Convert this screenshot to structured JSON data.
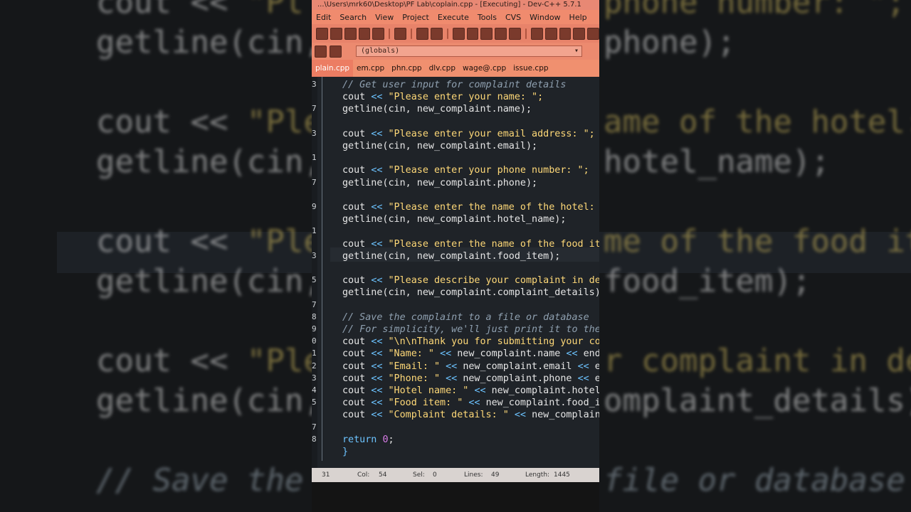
{
  "window": {
    "title": "...\\Users\\mrk60\\Desktop\\PF Lab\\coplain.cpp - [Executing] - Dev-C++ 5.7.1",
    "menu": [
      "Edit",
      "Search",
      "View",
      "Project",
      "Execute",
      "Tools",
      "CVS",
      "Window",
      "Help"
    ],
    "scope_select": "(globals)",
    "tabs": [
      "plain.cpp",
      "em.cpp",
      "phn.cpp",
      "dlv.cpp",
      "wage@.cpp",
      "issue.cpp"
    ],
    "active_tab": "plain.cpp"
  },
  "code": {
    "gutter": [
      "3",
      "",
      "7",
      "",
      "3",
      "",
      "1",
      "",
      "7",
      "",
      "9",
      "",
      "1",
      "",
      "3",
      "",
      "5",
      "",
      "7",
      "8",
      "9",
      "0",
      "1",
      "2",
      "3",
      "4",
      "5",
      "",
      "7",
      "8"
    ],
    "lines": [
      {
        "text": "// Get user input for complaint details",
        "kind": "comment"
      },
      {
        "a": "cout ",
        "b": "<< ",
        "c": "\"Please enter your name: \";",
        "kind": "cout"
      },
      {
        "a": "getline(cin, new_complaint.name);",
        "kind": "plain"
      },
      {
        "a": "",
        "kind": "blank"
      },
      {
        "a": "cout ",
        "b": "<< ",
        "c": "\"Please enter your email address: \";",
        "kind": "cout"
      },
      {
        "a": "getline(cin, new_complaint.email);",
        "kind": "plain"
      },
      {
        "a": "",
        "kind": "blank"
      },
      {
        "a": "cout ",
        "b": "<< ",
        "c": "\"Please enter your phone number: \";",
        "kind": "cout"
      },
      {
        "a": "getline(cin, new_complaint.phone);",
        "kind": "plain"
      },
      {
        "a": "",
        "kind": "blank"
      },
      {
        "a": "cout ",
        "b": "<< ",
        "c": "\"Please enter the name of the hotel: ",
        "kind": "cout"
      },
      {
        "a": "getline(cin, new_complaint.hotel_name);",
        "kind": "plain"
      },
      {
        "a": "",
        "kind": "blank"
      },
      {
        "a": "cout ",
        "b": "<< ",
        "c": "\"Please enter the name of the food it",
        "kind": "cout"
      },
      {
        "a": "getline(cin, new_complaint.food_item);",
        "kind": "plain"
      },
      {
        "a": "",
        "kind": "blank"
      },
      {
        "a": "cout ",
        "b": "<< ",
        "c": "\"Please describe your complaint in de",
        "kind": "cout"
      },
      {
        "a": "getline(cin, new_complaint.complaint_details);",
        "kind": "plain"
      },
      {
        "a": "",
        "kind": "blank"
      },
      {
        "text": "// Save the complaint to a file or database",
        "kind": "comment"
      },
      {
        "text": "// For simplicity, we'll just print it to the",
        "kind": "comment"
      },
      {
        "a": "cout ",
        "b": "<< ",
        "c": "\"\\n\\nThank you for submitting your com",
        "kind": "cout"
      },
      {
        "a": "cout ",
        "b": "<< ",
        "c": "\"Name: \" ",
        "d": "<< ",
        "e": "new_complaint.name ",
        "f": "<< ",
        "g": "endl",
        "kind": "cout2"
      },
      {
        "a": "cout ",
        "b": "<< ",
        "c": "\"Email: \" ",
        "d": "<< ",
        "e": "new_complaint.email ",
        "f": "<< ",
        "g": "en",
        "kind": "cout2"
      },
      {
        "a": "cout ",
        "b": "<< ",
        "c": "\"Phone: \" ",
        "d": "<< ",
        "e": "new_complaint.phone ",
        "f": "<< ",
        "g": "en",
        "kind": "cout2"
      },
      {
        "a": "cout ",
        "b": "<< ",
        "c": "\"Hotel name: \" ",
        "d": "<< ",
        "e": "new_complaint.hotel_",
        "kind": "cout2"
      },
      {
        "a": "cout ",
        "b": "<< ",
        "c": "\"Food item: \" ",
        "d": "<< ",
        "e": "new_complaint.food_it",
        "kind": "cout2"
      },
      {
        "a": "cout ",
        "b": "<< ",
        "c": "\"Complaint details: \" ",
        "d": "<< ",
        "e": "new_complaint",
        "kind": "cout2"
      },
      {
        "a": "",
        "kind": "blank"
      },
      {
        "a": "return ",
        "n": "0",
        "z": ";",
        "kind": "return"
      },
      {
        "a": "}",
        "kind": "brace"
      }
    ]
  },
  "status": {
    "line": "31",
    "col_label": "Col:",
    "col": "54",
    "sel_label": "Sel:",
    "sel": "0",
    "lines_label": "Lines:",
    "lines": "49",
    "length_label": "Length:",
    "length": "1445"
  },
  "background_zoom": {
    "lines": [
      {
        "a": "cout << ",
        "s": "\"Pl",
        "right": "phone number: \";"
      },
      {
        "a": "getline(cin,",
        "s": "",
        "right": "phone);"
      },
      {
        "a": "",
        "s": "",
        "right": ""
      },
      {
        "a": "cout << ",
        "s": "\"Ple",
        "right": "ame of the hotel:"
      },
      {
        "a": "getline(cin,",
        "s": "",
        "right": "hotel_name);"
      },
      {
        "a": "",
        "s": "",
        "right": ""
      },
      {
        "a": "cout << ",
        "s": "\"Ple",
        "right": "me of the food ite"
      },
      {
        "a": "getline(cin,",
        "s": "",
        "right": "food_item);"
      },
      {
        "a": "",
        "s": "",
        "right": ""
      },
      {
        "a": "cout << ",
        "s": "\"Ple",
        "right": "r complaint in det"
      },
      {
        "a": "getline(cin,",
        "s": "",
        "right": "omplaint_details);"
      },
      {
        "a": "",
        "s": "",
        "right": ""
      },
      {
        "a": "// Save the",
        "s": "",
        "right": "file or database"
      }
    ]
  }
}
